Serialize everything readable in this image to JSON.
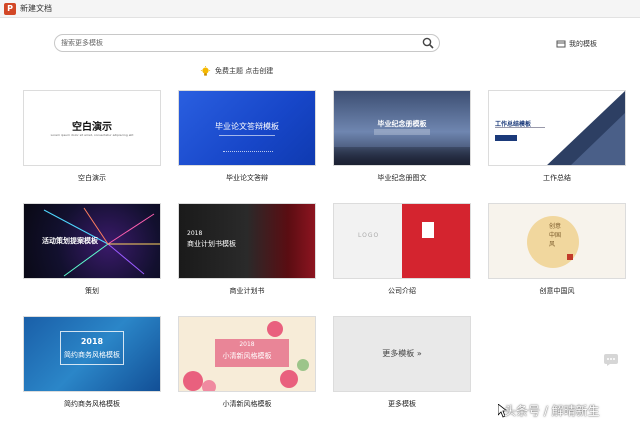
{
  "window": {
    "app_logo": "P",
    "title": "新建文档"
  },
  "search": {
    "placeholder": "搜索更多模板"
  },
  "header": {
    "my_templates": "我的模板",
    "free_theme": "免费主题 点击创建"
  },
  "colors": {
    "accent_blue": "#1746c8",
    "accent_red": "#d4242f",
    "logo_orange": "#d24726"
  },
  "templates": [
    {
      "label": "空白演示",
      "thumb_title": "空白演示",
      "thumb_sub": "Lorem ipsum dolor sit amet, consectetur adipiscing elit"
    },
    {
      "label": "毕业论文答辩",
      "thumb_title": "毕业论文答辩模板"
    },
    {
      "label": "毕业纪念册图文",
      "thumb_title": "毕业纪念册模板"
    },
    {
      "label": "工作总结",
      "thumb_title": "工作总结模板"
    },
    {
      "label": "策划",
      "thumb_title": "活动策划提案模板"
    },
    {
      "label": "商业计划书",
      "thumb_year": "2018",
      "thumb_title": "商业计划书模板"
    },
    {
      "label": "公司介绍",
      "thumb_title": "LOGO"
    },
    {
      "label": "创意中国风",
      "thumb_title": "创意中国风"
    },
    {
      "label": "简约商务风格模板",
      "thumb_year": "2018",
      "thumb_title": "简约商务风格模板"
    },
    {
      "label": "小清新风格模板",
      "thumb_year": "2018",
      "thumb_title": "小清新风格模板"
    },
    {
      "label": "更多模板",
      "thumb_title": "更多模板 »"
    }
  ],
  "icons": [
    "search-icon",
    "my-templates-icon",
    "lightbulb-icon",
    "chat-icon",
    "cursor-icon"
  ],
  "watermark": "头条号 / 解晴新生"
}
